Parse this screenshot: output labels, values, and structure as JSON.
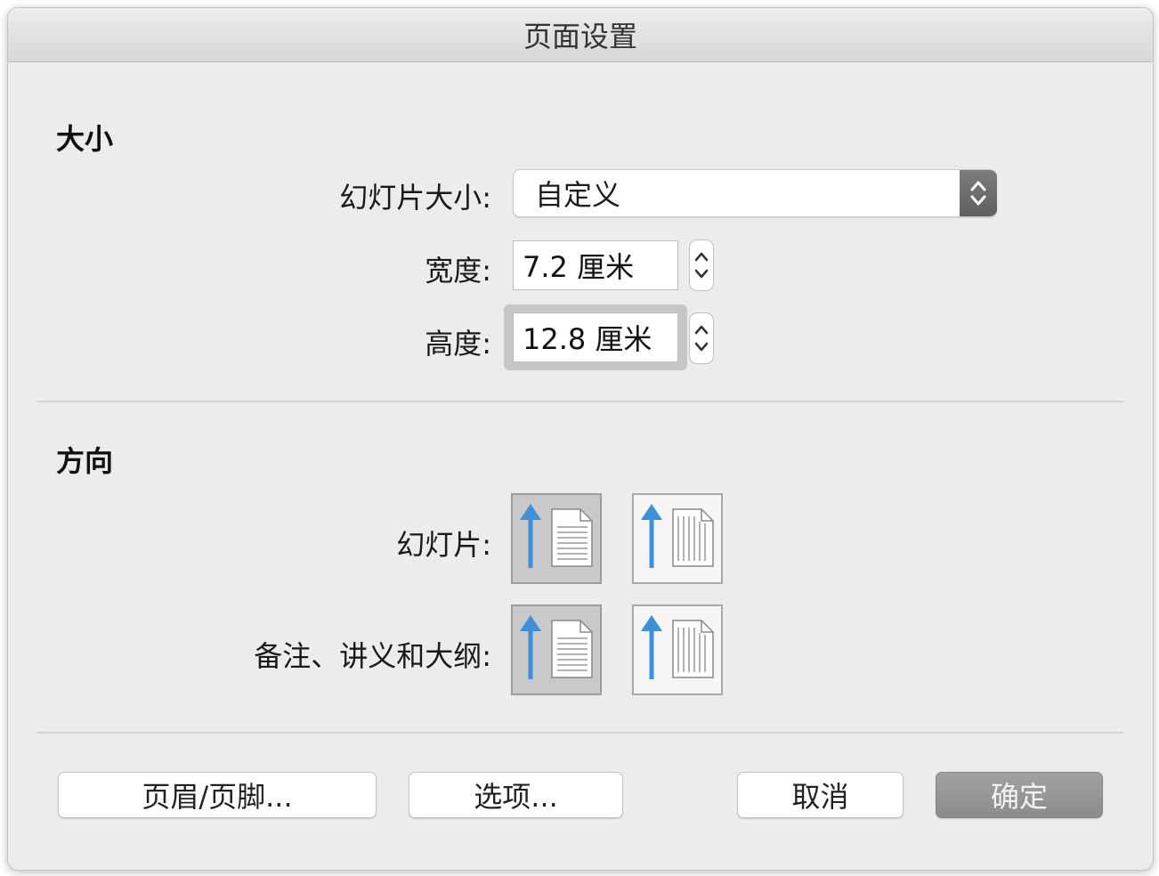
{
  "title": "页面设置",
  "size_section": {
    "heading": "大小",
    "slide_size_label": "幻灯片大小:",
    "slide_size_value": "自定义",
    "width_label": "宽度:",
    "width_value": "7.2 厘米",
    "height_label": "高度:",
    "height_value": "12.8 厘米"
  },
  "orientation_section": {
    "heading": "方向",
    "slides_label": "幻灯片:",
    "notes_label": "备注、讲义和大纲:",
    "portrait_icon": "portrait-page-icon",
    "landscape_icon": "landscape-page-icon",
    "selected": {
      "slides": "portrait",
      "notes": "portrait"
    }
  },
  "buttons": {
    "header_footer": "页眉/页脚...",
    "options": "选项...",
    "cancel": "取消",
    "ok": "确定"
  },
  "colors": {
    "accent_arrow": "#3f8fd9",
    "dialog_bg": "#ececec",
    "ok_button": "#969696"
  }
}
